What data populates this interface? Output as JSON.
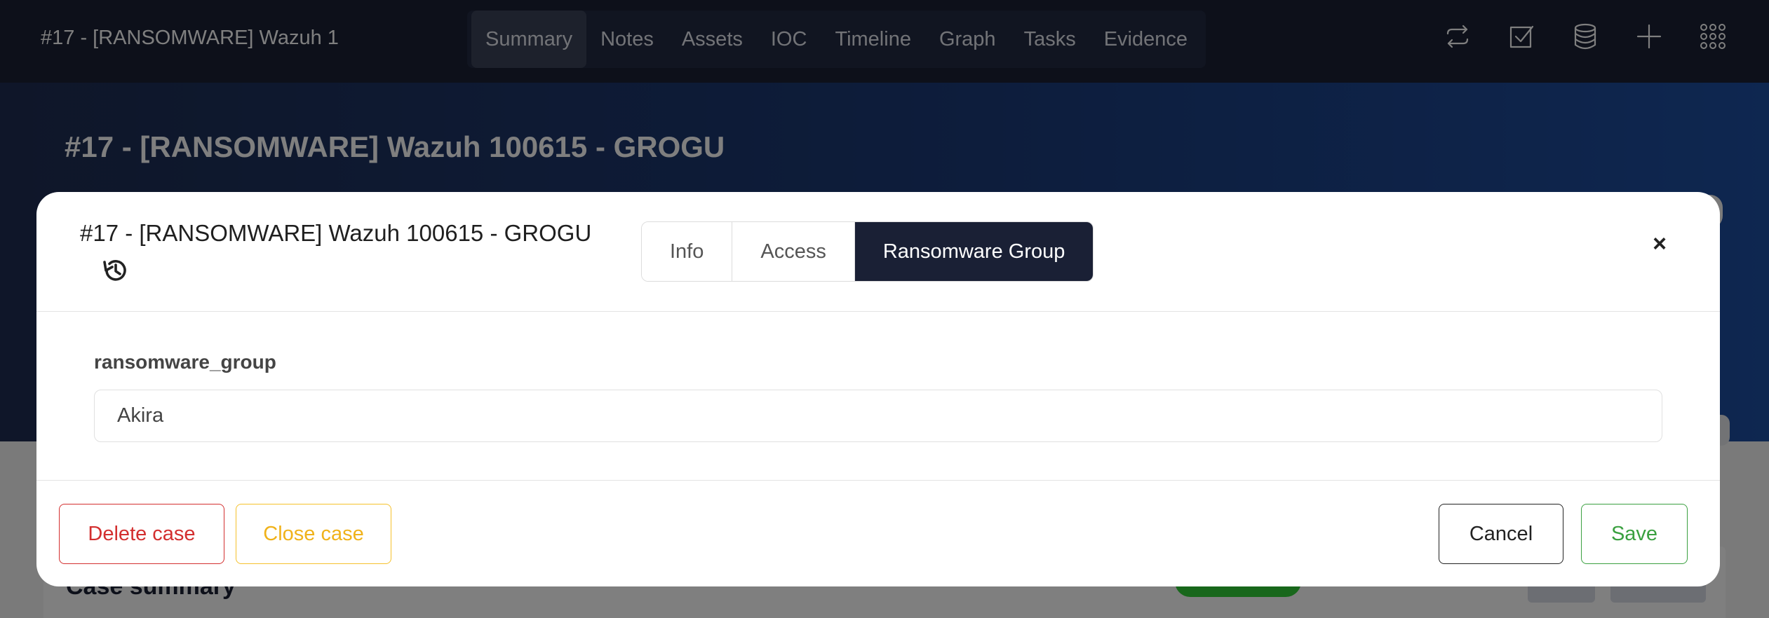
{
  "app": {
    "title": "#17 - [RANSOMWARE] Wazuh 1",
    "nav_tabs": [
      {
        "label": "Summary",
        "active": true
      },
      {
        "label": "Notes"
      },
      {
        "label": "Assets"
      },
      {
        "label": "IOC"
      },
      {
        "label": "Timeline"
      },
      {
        "label": "Graph"
      },
      {
        "label": "Tasks"
      },
      {
        "label": "Evidence"
      }
    ],
    "top_icons": [
      "refresh-icon",
      "checkbox-icon",
      "database-icon",
      "plus-icon",
      "grid-menu-icon"
    ]
  },
  "page": {
    "heading": "#17 - [RANSOMWARE] Wazuh 100615 - GROGU",
    "summary_title": "Case summary"
  },
  "modal": {
    "title": "#17 - [RANSOMWARE] Wazuh 100615 - GROGU",
    "history_icon": "history-icon",
    "tabs": [
      {
        "label": "Info"
      },
      {
        "label": "Access"
      },
      {
        "label": "Ransomware Group",
        "active": true
      }
    ],
    "close_symbol": "×",
    "field": {
      "label": "ransomware_group",
      "value": "Akira"
    },
    "buttons": {
      "delete": "Delete case",
      "close_case": "Close case",
      "cancel": "Cancel",
      "save": "Save"
    }
  },
  "colors": {
    "navbar": "#1a2035",
    "active_tab": "#1a2035",
    "delete": "#d32f2f",
    "close_case": "#f0b21a",
    "save": "#3aa040"
  }
}
